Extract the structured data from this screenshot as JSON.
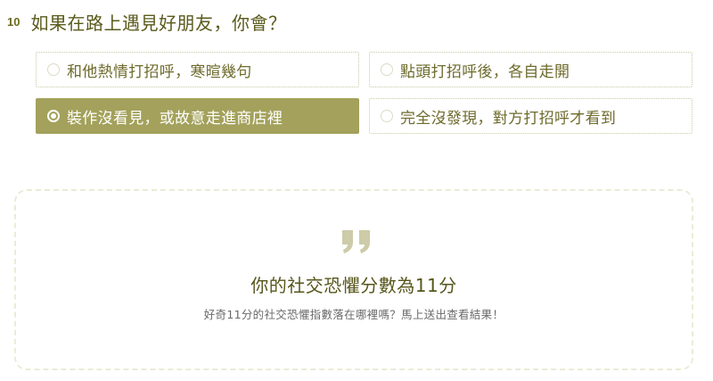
{
  "question": {
    "number": "10",
    "text": "如果在路上遇見好朋友，你會？"
  },
  "options": [
    {
      "label": "和他熱情打招呼，寒暄幾句",
      "selected": false
    },
    {
      "label": "點頭打招呼後，各自走開",
      "selected": false
    },
    {
      "label": "裝作沒看見，或故意走進商店裡",
      "selected": true
    },
    {
      "label": "完全沒發現，對方打招呼才看到",
      "selected": false
    }
  ],
  "result": {
    "title": "你的社交恐懼分數為11分",
    "subtitle": "好奇11分的社交恐懼指數落在哪裡嗎？馬上送出查看結果！"
  },
  "colors": {
    "accent": "#a3a15b",
    "text_olive": "#5a5a1c",
    "border_dotted": "#c9c9a8",
    "card_border": "#ecebd6",
    "quote_icon": "#cdcba8"
  },
  "icons": {
    "quote": "double-quote-icon",
    "radio": "radio-button-icon"
  }
}
